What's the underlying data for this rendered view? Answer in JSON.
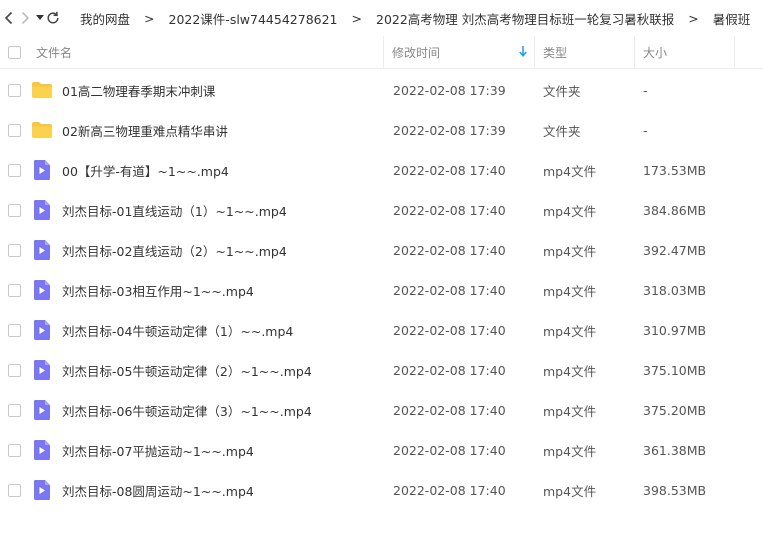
{
  "breadcrumb": {
    "items": [
      "我的网盘",
      "2022课件-slw74454278621",
      "2022高考物理 刘杰高考物理目标班一轮复习暑秋联报",
      "暑假班"
    ],
    "separator": ">"
  },
  "columns": {
    "name": "文件名",
    "modified": "修改时间",
    "type": "类型",
    "size": "大小"
  },
  "files": [
    {
      "name": "01高二物理春季期末冲刺课",
      "modified": "2022-02-08 17:39",
      "type": "文件夹",
      "size": "-",
      "icon": "folder-icon"
    },
    {
      "name": "02新高三物理重难点精华串讲",
      "modified": "2022-02-08 17:39",
      "type": "文件夹",
      "size": "-",
      "icon": "folder-icon"
    },
    {
      "name": "00【升学-有道】~1~~.mp4",
      "modified": "2022-02-08 17:40",
      "type": "mp4文件",
      "size": "173.53MB",
      "icon": "video-file-icon"
    },
    {
      "name": "刘杰目标-01直线运动（1）~1~~.mp4",
      "modified": "2022-02-08 17:40",
      "type": "mp4文件",
      "size": "384.86MB",
      "icon": "video-file-icon"
    },
    {
      "name": "刘杰目标-02直线运动（2）~1~~.mp4",
      "modified": "2022-02-08 17:40",
      "type": "mp4文件",
      "size": "392.47MB",
      "icon": "video-file-icon"
    },
    {
      "name": "刘杰目标-03相互作用~1~~.mp4",
      "modified": "2022-02-08 17:40",
      "type": "mp4文件",
      "size": "318.03MB",
      "icon": "video-file-icon"
    },
    {
      "name": "刘杰目标-04牛顿运动定律（1）~~.mp4",
      "modified": "2022-02-08 17:40",
      "type": "mp4文件",
      "size": "310.97MB",
      "icon": "video-file-icon"
    },
    {
      "name": "刘杰目标-05牛顿运动定律（2）~1~~.mp4",
      "modified": "2022-02-08 17:40",
      "type": "mp4文件",
      "size": "375.10MB",
      "icon": "video-file-icon"
    },
    {
      "name": "刘杰目标-06牛顿运动定律（3）~1~~.mp4",
      "modified": "2022-02-08 17:40",
      "type": "mp4文件",
      "size": "375.20MB",
      "icon": "video-file-icon"
    },
    {
      "name": "刘杰目标-07平抛运动~1~~.mp4",
      "modified": "2022-02-08 17:40",
      "type": "mp4文件",
      "size": "361.38MB",
      "icon": "video-file-icon"
    },
    {
      "name": "刘杰目标-08圆周运动~1~~.mp4",
      "modified": "2022-02-08 17:40",
      "type": "mp4文件",
      "size": "398.53MB",
      "icon": "video-file-icon"
    }
  ],
  "colors": {
    "folder": "#f9c73d",
    "video": "#7b76f2",
    "sort_arrow": "#1a9bf0"
  }
}
